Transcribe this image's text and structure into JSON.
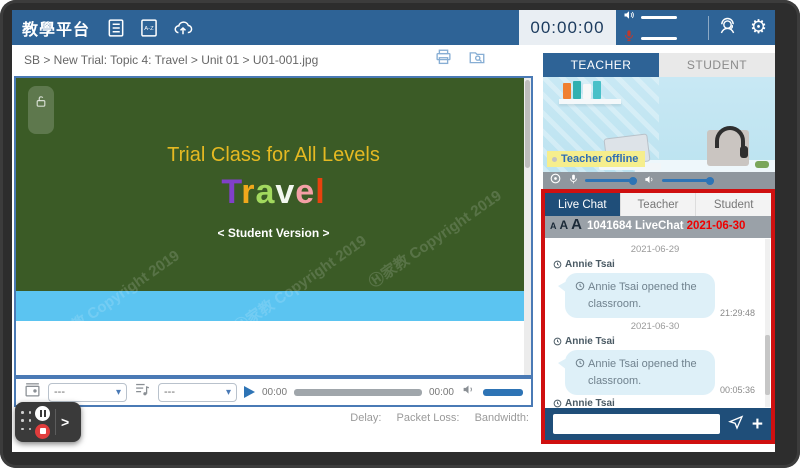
{
  "app": {
    "title": "教學平台"
  },
  "topbar": {
    "timer": "00:00:00"
  },
  "breadcrumb": {
    "path": "SB > New Trial: Topic 4: Travel > Unit 01 > U01-001.jpg"
  },
  "slide": {
    "title": "Trial Class for All Levels",
    "travel_letters": [
      {
        "ch": "T",
        "color": "#8040c8"
      },
      {
        "ch": "r",
        "color": "#f0a81c"
      },
      {
        "ch": "a",
        "color": "#a2d95e"
      },
      {
        "ch": "v",
        "color": "#f2f7ef"
      },
      {
        "ch": "e",
        "color": "#f4a0a6"
      },
      {
        "ch": "l",
        "color": "#e8420e"
      }
    ],
    "subtitle": "< Student Version >"
  },
  "player": {
    "media_select": "---",
    "audio_select": "---",
    "elapsed": "00:00",
    "total": "00:00"
  },
  "status": {
    "delay": "Delay:",
    "packet_loss": "Packet Loss:",
    "bandwidth": "Bandwidth:"
  },
  "video_panel": {
    "teacher_tab": "TEACHER",
    "student_tab": "STUDENT",
    "offline": "Teacher offline"
  },
  "chat": {
    "tab_live": "Live Chat",
    "tab_teacher": "Teacher",
    "tab_student": "Student",
    "font_small": "A",
    "font_medium": "A",
    "font_large": "A",
    "session": "1041684 LiveChat",
    "date": "2021-06-30",
    "messages": [
      {
        "text": "2021-06-29"
      },
      {
        "text": "Annie Tsai"
      },
      {
        "text": "Annie Tsai opened the classroom.",
        "time": "21:29:48"
      },
      {
        "text": "2021-06-30"
      },
      {
        "text": "Annie Tsai"
      },
      {
        "text": "Annie Tsai opened the classroom.",
        "time": "00:05:36"
      },
      {
        "text": "Annie Tsai"
      }
    ]
  },
  "watermark": {
    "text": "Ⓗ家教 Copyright 2019"
  },
  "colors": {
    "topbar_blue": "#2e6396",
    "accent_blue": "#2e74b5",
    "chat_dark_blue": "#1f4e79",
    "highlight_red": "#cf1010",
    "slide_green": "#3b5b26",
    "title_yellow": "#e5b922",
    "band_blue": "#5bc4f1",
    "offline_yellow": "#f6ee8d"
  }
}
